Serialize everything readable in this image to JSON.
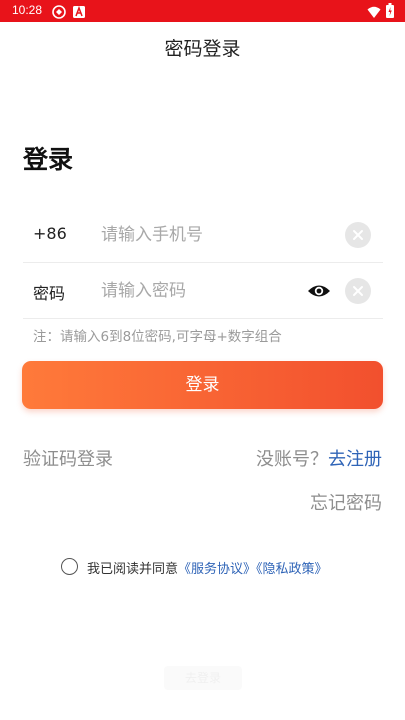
{
  "status_bar": {
    "time": "10:28",
    "background_color": "#e8131a"
  },
  "header": {
    "title": "密码登录"
  },
  "main": {
    "heading": "登录",
    "phone": {
      "country_code": "+86",
      "placeholder": "请输入手机号",
      "value": ""
    },
    "password": {
      "label": "密码",
      "placeholder": "请输入密码",
      "value": ""
    },
    "hint": "注：请输入6到8位密码,可字母+数字组合",
    "login_button": "登录",
    "login_button_colors": [
      "#ff7a3a",
      "#f2502e"
    ]
  },
  "links": {
    "sms_login": "验证码登录",
    "no_account": "没账号？",
    "register": "去注册",
    "forgot_password": "忘记密码",
    "link_color": "#2f64b7"
  },
  "agreement": {
    "checked": false,
    "prefix": "我已阅读并同意",
    "service": "《服务协议》",
    "privacy": "《隐私政策》"
  },
  "footer": {
    "faded_label": "去登录"
  },
  "icons": {
    "status": [
      "notification-icon",
      "app-a-icon",
      "wifi-icon",
      "battery-icon"
    ],
    "clear": "clear-icon",
    "visibility": "eye-icon"
  }
}
